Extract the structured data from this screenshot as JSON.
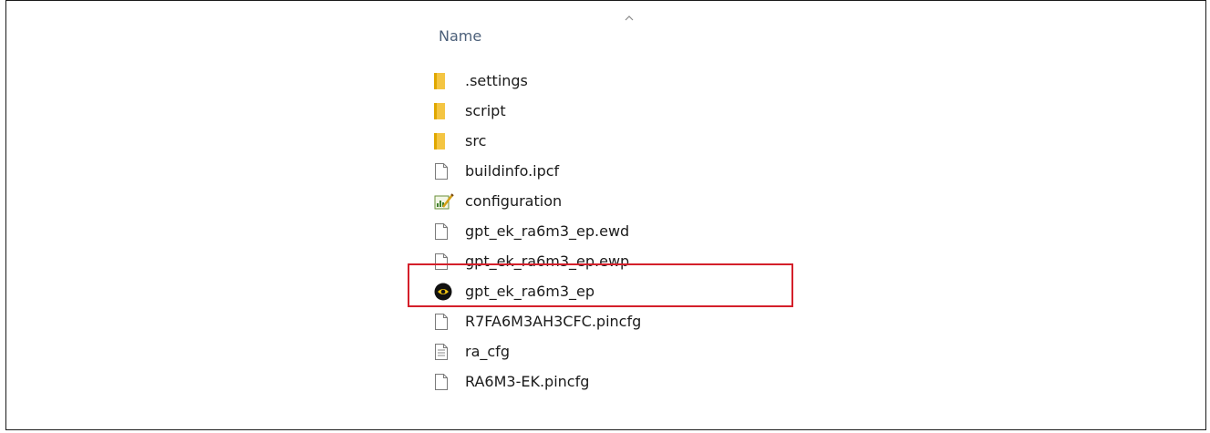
{
  "header": {
    "name_label": "Name"
  },
  "files": [
    {
      "name": ".settings",
      "icon": "folder-icon"
    },
    {
      "name": "script",
      "icon": "folder-icon"
    },
    {
      "name": "src",
      "icon": "folder-icon"
    },
    {
      "name": "buildinfo.ipcf",
      "icon": "file-icon"
    },
    {
      "name": "configuration",
      "icon": "configuration-icon"
    },
    {
      "name": "gpt_ek_ra6m3_ep.ewd",
      "icon": "file-icon"
    },
    {
      "name": "gpt_ek_ra6m3_ep.ewp",
      "icon": "file-icon"
    },
    {
      "name": "gpt_ek_ra6m3_ep",
      "icon": "workspace-icon"
    },
    {
      "name": "R7FA6M3AH3CFC.pincfg",
      "icon": "file-icon"
    },
    {
      "name": "ra_cfg",
      "icon": "text-file-icon"
    },
    {
      "name": "RA6M3-EK.pincfg",
      "icon": "file-icon"
    }
  ],
  "colors": {
    "folder": "#f4c542",
    "highlight": "#d41f2a",
    "header_text": "#4c607a"
  }
}
